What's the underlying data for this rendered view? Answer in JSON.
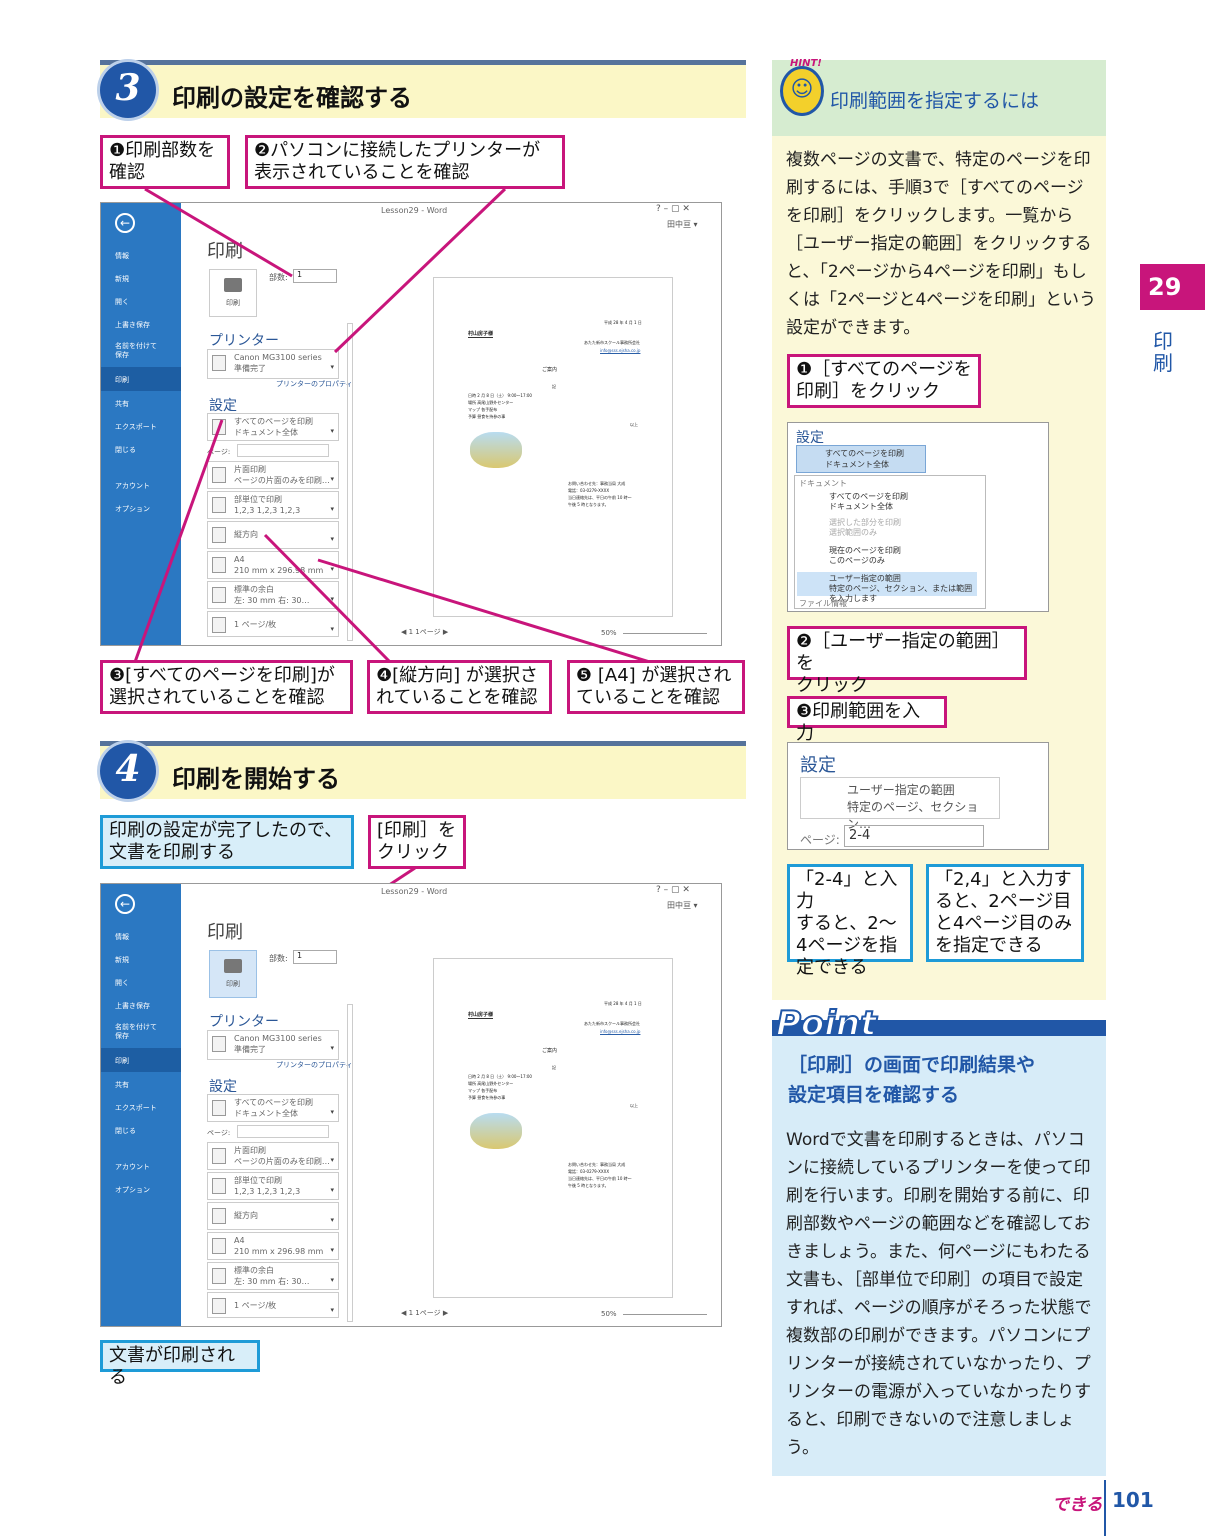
{
  "colors": {
    "magenta": "#c8157b",
    "blue": "#2157a7",
    "word_blue": "#2b78c2",
    "hint_bg": "#fbf8d8",
    "point_blue": "#1e9bd7"
  },
  "step3": {
    "number": "3",
    "title": "印刷の設定を確認する",
    "callouts": {
      "c1": "❶印刷部数を\n確認",
      "c2": "❷パソコンに接続したプリンターが\n表示されていることを確認",
      "c3": "❸[すべてのページを印刷]が\n選択されていることを確認",
      "c4": "❹[縦方向] が選択さ\nれていることを確認",
      "c5": "❺ [A4] が選択され\nていることを確認"
    }
  },
  "step4": {
    "number": "4",
    "title": "印刷を開始する",
    "callouts": {
      "c1": "印刷の設定が完了したので、\n文書を印刷する",
      "c2": "[印刷］を\nクリック",
      "c3": "文書が印刷される"
    }
  },
  "word": {
    "window_title": "Lesson29 - Word",
    "controls": "?  –  ▢  ✕",
    "user": "田中亘 ▾",
    "menu": [
      "情報",
      "新規",
      "開く",
      "上書き保存",
      "名前を付けて\n保存",
      "印刷",
      "共有",
      "エクスポート",
      "閉じる",
      "アカウント",
      "オプション"
    ],
    "print_heading": "印刷",
    "copies_label": "部数:",
    "copies_value": "1",
    "print_button": "印刷",
    "printer_heading": "プリンター",
    "printer_name": "Canon MG3100 series",
    "printer_status": "準備完了",
    "printer_props": "プリンターのプロパティ",
    "settings_heading": "設定",
    "pages_label": "ページ:",
    "fields": [
      {
        "l1": "すべてのページを印刷",
        "l2": "ドキュメント全体"
      },
      {
        "l1": "片面印刷",
        "l2": "ページの片面のみを印刷…"
      },
      {
        "l1": "部単位で印刷",
        "l2": "1,2,3   1,2,3   1,2,3"
      },
      {
        "l1": "縦方向",
        "l2": ""
      },
      {
        "l1": "A4",
        "l2": "210 mm x 296.98 mm"
      },
      {
        "l1": "標準の余白",
        "l2": "左: 30 mm   右: 30…"
      },
      {
        "l1": "1 ページ/枚",
        "l2": ""
      }
    ],
    "page_nav": "◀  1  1ページ  ▶",
    "zoom": "50%",
    "doc": {
      "date": "平成 28 年 4 月 1 日",
      "to": "村山房子様",
      "from": "あたた新市スクール事務所会社",
      "link": "info@sss.ejsha.co.jp",
      "title": "ご案内",
      "ki": "記",
      "items": [
        "日時     2 月 8 日（土） 9:00〜17:00",
        "場所     高尾山野外センター",
        "マップ     各手配布",
        "予算     昼食を持参の事"
      ],
      "ijo": "以上",
      "contact": "お問い合わせ先：事務当局  大成\n電話：03-0279-XXXX\n当日連絡先は、平日の午前 10 時〜\n午後 5 時となります。"
    }
  },
  "sidebar_tab": {
    "number": "29",
    "label": "印\n刷"
  },
  "hint": {
    "badge": "HINT!",
    "title": "印刷範囲を指定するには",
    "body": "複数ページの文書で、特定のページを印刷するには、手順3で［すべてのページを印刷］をクリックします。一覧から［ユーザー指定の範囲］をクリックすると、「2ページから4ページを印刷」もしくは「2ページと4ページを印刷」という設定ができます。",
    "c1": "❶［すべてのページを\n印刷］をクリック",
    "c2": "❷［ユーザー指定の範囲］を\nクリック",
    "c3": "❸印刷範囲を入力",
    "c4": "「2-4」と入力\nすると、2～\n4ページを指\n定できる",
    "c5": "「2,4」と入力す\nると、2ページ目\nと4ページ目のみ\nを指定できる",
    "shot1": {
      "heading": "設定",
      "sel1": "すべてのページを印刷",
      "sel2": "ドキュメント全体",
      "group": "ドキュメント",
      "opts": [
        {
          "t": "すべてのページを印刷",
          "s": "ドキュメント全体"
        },
        {
          "t": "選択した部分を印刷",
          "s": "選択範囲のみ"
        },
        {
          "t": "現在のページを印刷",
          "s": "このページのみ"
        },
        {
          "t": "ユーザー指定の範囲",
          "s": "特定のページ、セクション、または範囲を入力します"
        }
      ],
      "footer": "ファイル情報"
    },
    "shot2": {
      "heading": "設定",
      "sel1": "ユーザー指定の範囲",
      "sel2": "特定のページ、セクション…",
      "pages_label": "ページ:",
      "pages_value": "2-4"
    }
  },
  "point": {
    "title": "Point",
    "subtitle": "［印刷］の画面で印刷結果や\n設定項目を確認する",
    "body": "Wordで文書を印刷するときは、パソコンに接続しているプリンターを使って印刷を行います。印刷を開始する前に、印刷部数やページの範囲などを確認しておきましょう。また、何ページにもわたる文書も、［部単位で印刷］の項目で設定すれば、ページの順序がそろった状態で複数部の印刷ができます。パソコンにプリンターが接続されていなかったり、プリンターの電源が入っていなかったりすると、印刷できないので注意しましょう。"
  },
  "footer": {
    "brand": "できる",
    "page": "101"
  }
}
